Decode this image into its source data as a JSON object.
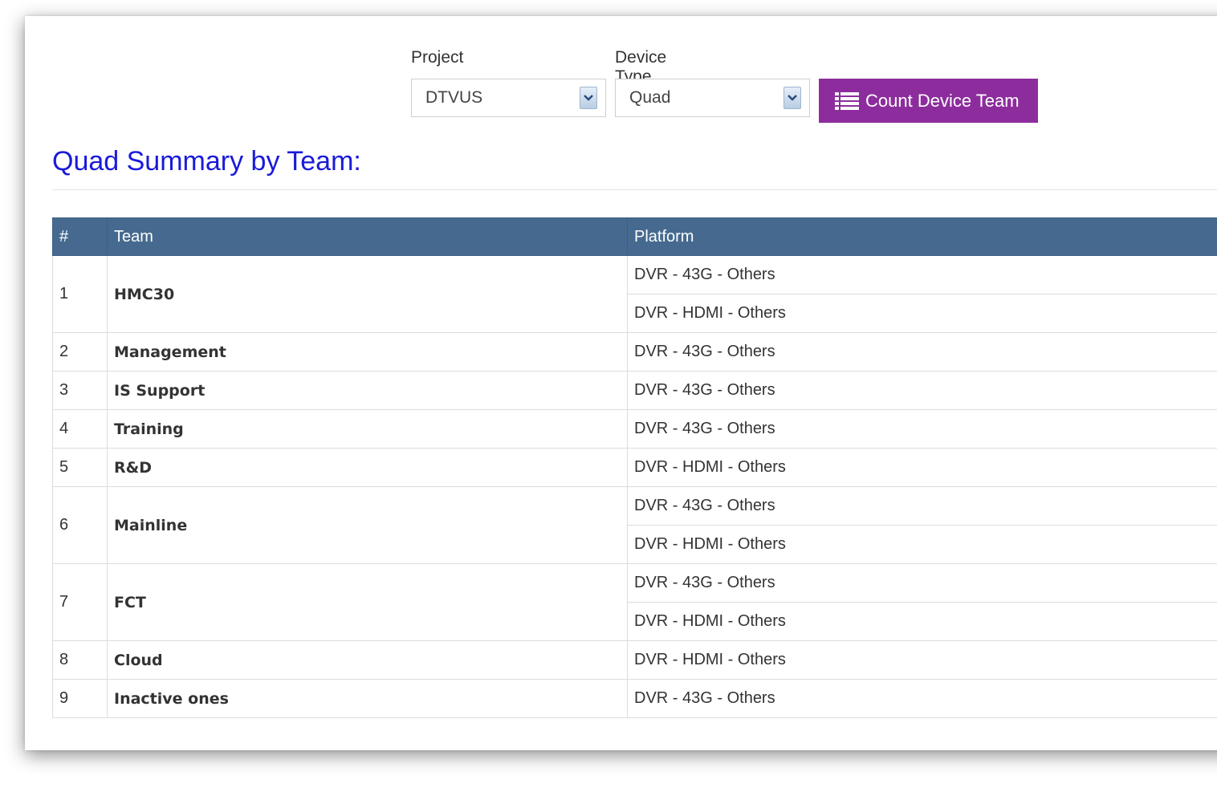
{
  "filters": {
    "project_label": "Project",
    "project_value": "DTVUS",
    "device_type_label": "Device Type",
    "device_type_value": "Quad",
    "count_button_label": "Count Device Team"
  },
  "summary": {
    "title": "Quad Summary by Team:"
  },
  "table": {
    "headers": [
      "#",
      "Team",
      "Platform"
    ],
    "rows": [
      {
        "num": "1",
        "team": "HMC30",
        "platforms": [
          "DVR - 43G - Others",
          "DVR - HDMI - Others"
        ]
      },
      {
        "num": "2",
        "team": "Management",
        "platforms": [
          "DVR - 43G - Others"
        ]
      },
      {
        "num": "3",
        "team": "IS Support",
        "platforms": [
          "DVR - 43G - Others"
        ]
      },
      {
        "num": "4",
        "team": "Training",
        "platforms": [
          "DVR - 43G - Others"
        ]
      },
      {
        "num": "5",
        "team": "R&D",
        "platforms": [
          "DVR - HDMI - Others"
        ]
      },
      {
        "num": "6",
        "team": "Mainline",
        "platforms": [
          "DVR - 43G - Others",
          "DVR - HDMI - Others"
        ]
      },
      {
        "num": "7",
        "team": "FCT",
        "platforms": [
          "DVR - 43G - Others",
          "DVR - HDMI - Others"
        ]
      },
      {
        "num": "8",
        "team": "Cloud",
        "platforms": [
          "DVR - HDMI - Others"
        ]
      },
      {
        "num": "9",
        "team": "Inactive ones",
        "platforms": [
          "DVR - 43G - Others"
        ]
      }
    ]
  },
  "colors": {
    "header_bg": "#466a8f",
    "button_bg": "#8d2d9d",
    "title_color": "#1a1ad9"
  },
  "icons": {
    "button_icon": "list-icon",
    "select_icon": "chevron-down-icon"
  }
}
